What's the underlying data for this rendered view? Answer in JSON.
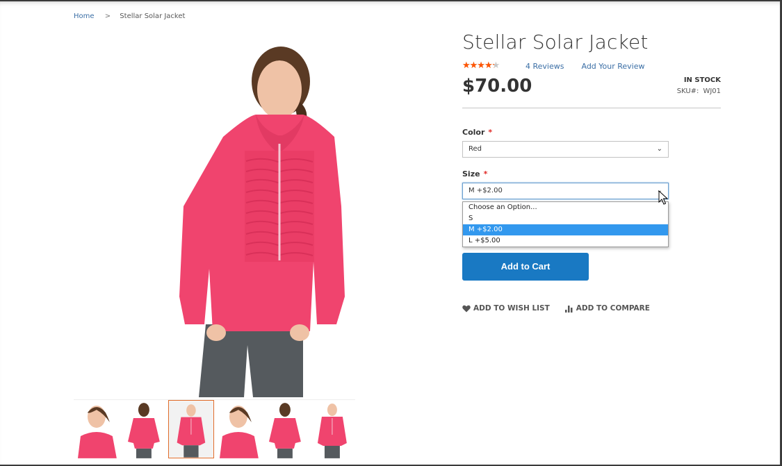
{
  "breadcrumb": {
    "items": [
      {
        "label": "Home",
        "link": true
      },
      {
        "label": "Stellar Solar Jacket",
        "link": false
      }
    ],
    "separator": ">"
  },
  "product": {
    "title": "Stellar Solar Jacket",
    "rating_percent": 70,
    "rating_stars": "★★★★★",
    "reviews_count_label": "4  Reviews",
    "add_review_label": "Add Your Review",
    "price": "$70.00",
    "stock_status": "In stock",
    "sku_label": "SKU#:",
    "sku_value": "WJ01"
  },
  "options": {
    "color": {
      "label": "Color",
      "required_mark": "*",
      "value": "Red",
      "chevron": "⌄"
    },
    "size": {
      "label": "Size",
      "required_mark": "*",
      "value": "M +$2.00",
      "chevron": "⌄",
      "dropdown_open": true,
      "items": [
        {
          "label": "Choose an Option...",
          "selected": false
        },
        {
          "label": "S",
          "selected": false
        },
        {
          "label": "M +$2.00",
          "selected": true
        },
        {
          "label": "L +$5.00",
          "selected": false
        }
      ]
    }
  },
  "actions": {
    "add_to_cart": "Add to Cart",
    "wish_list": "Add to Wish List",
    "compare": "Add to Compare"
  },
  "gallery": {
    "main_image": "Woman wearing pink Stellar Solar Jacket, front view",
    "thumbnails": [
      {
        "alt": "Close-up front, head turned",
        "active": false
      },
      {
        "alt": "Back view",
        "active": false
      },
      {
        "alt": "Full front view",
        "active": true
      },
      {
        "alt": "Close-up front",
        "active": false
      },
      {
        "alt": "Back view",
        "active": false
      },
      {
        "alt": "Front view",
        "active": false
      }
    ]
  },
  "colors": {
    "accent_blue": "#1979c3",
    "link_blue": "#3a6ea5",
    "star_orange": "#ff5501",
    "required_red": "#e02b27",
    "option_highlight": "#3298ee",
    "thumb_active_border": "#e06c2a",
    "jacket_pink": "#f0446e"
  }
}
